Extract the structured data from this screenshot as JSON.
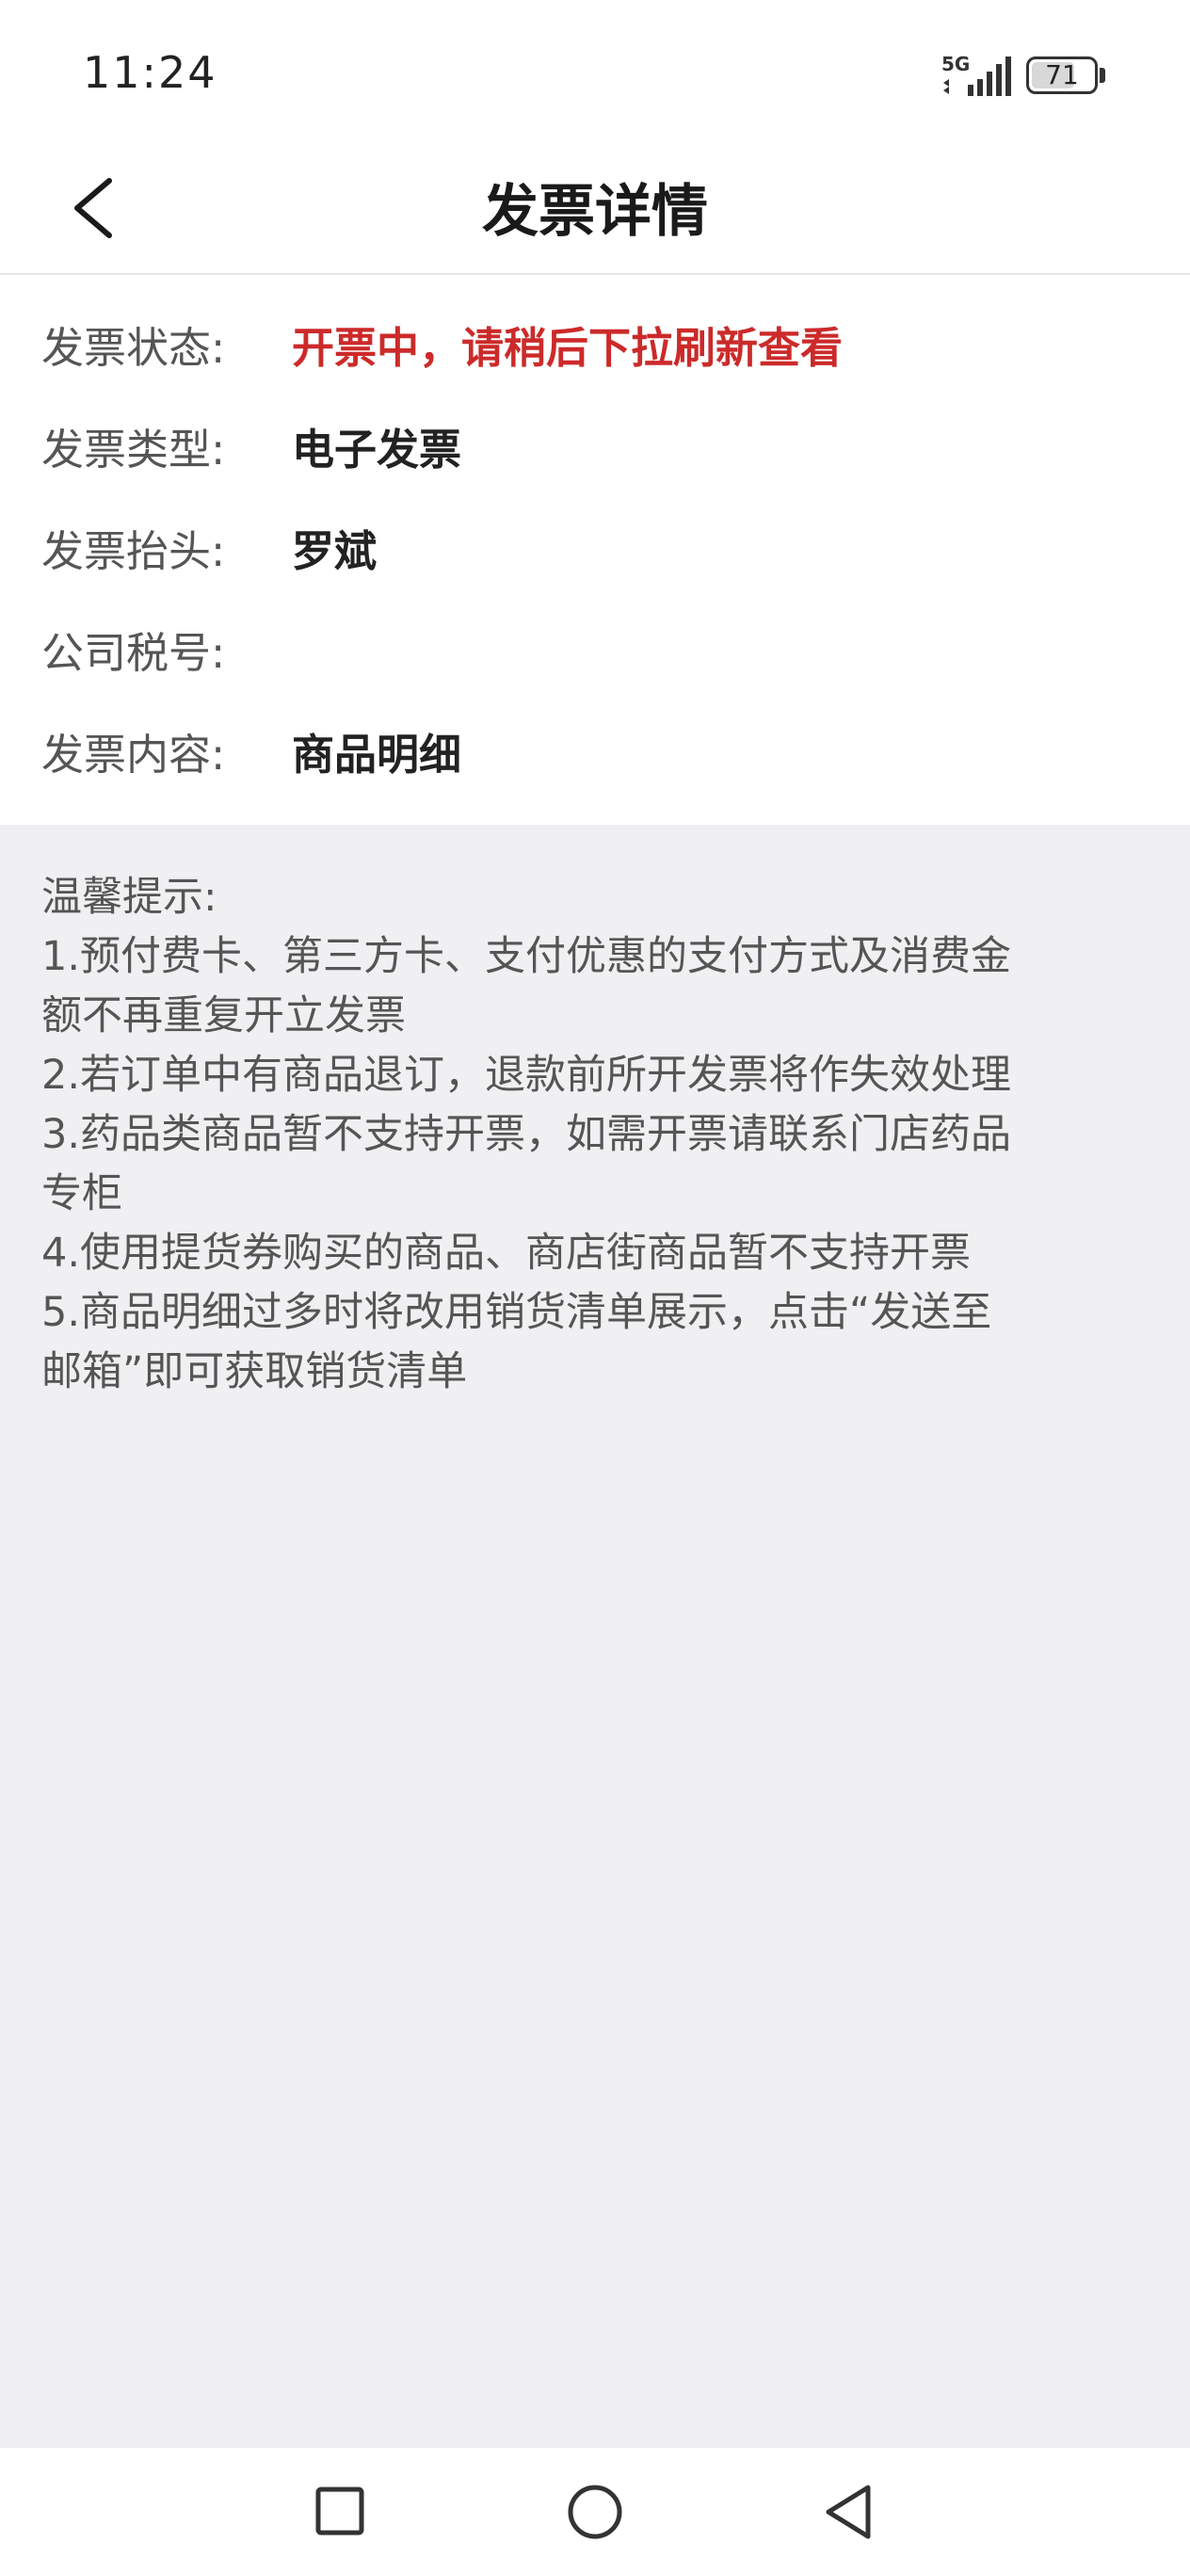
{
  "status_bar": {
    "time": "11:24",
    "network": "5G",
    "battery_level": "71",
    "battery_percent": 71
  },
  "header": {
    "title": "发票详情",
    "back_icon": "chevron-left-icon"
  },
  "invoice": {
    "status_label": "发票状态:",
    "status_value": "开票中，请稍后下拉刷新查看",
    "status_color": "#cc2a2a",
    "type_label": "发票类型:",
    "type_value": "电子发票",
    "title_label": "发票抬头:",
    "title_value": "罗斌",
    "tax_label": "公司税号:",
    "tax_value": "",
    "content_label": "发票内容:",
    "content_value": "商品明细"
  },
  "tips": {
    "lines": [
      "温馨提示:",
      "1.预付费卡、第三方卡、支付优惠的支付方式及消费金",
      "额不再重复开立发票",
      "2.若订单中有商品退订，退款前所开发票将作失效处理",
      "3.药品类商品暂不支持开票，如需开票请联系门店药品",
      "专柜",
      "4.使用提货券购买的商品、商店街商品暂不支持开票",
      "5.商品明细过多时将改用销货清单展示，点击“发送至",
      "邮箱”即可获取销货清单"
    ]
  },
  "system_nav": {
    "recents_icon": "square-icon",
    "home_icon": "circle-icon",
    "back_icon": "triangle-back-icon"
  }
}
